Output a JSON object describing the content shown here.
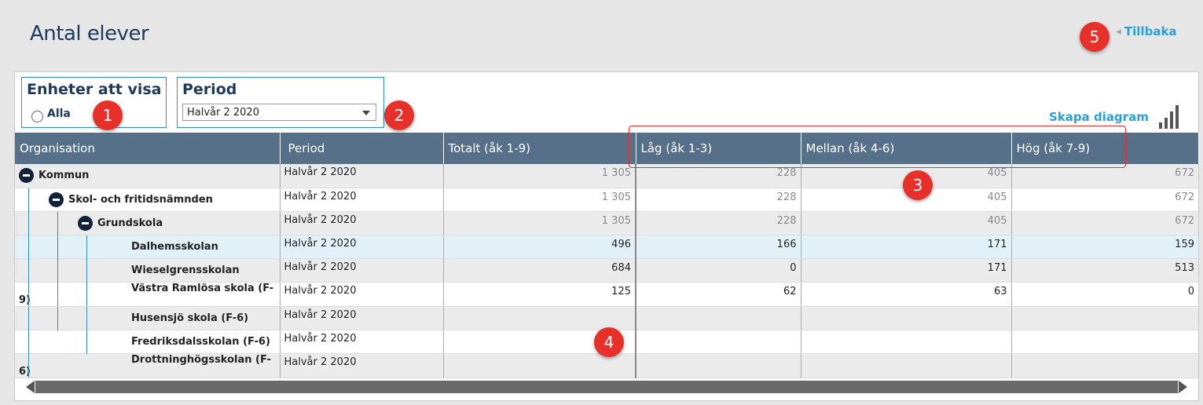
{
  "page": {
    "title": "Antal elever",
    "back_label": "Tillbaka"
  },
  "filters": {
    "units_title": "Enheter att visa",
    "units_option": "Alla",
    "period_title": "Period",
    "period_value": "Halvår 2 2020"
  },
  "chart_link": "Skapa diagram",
  "table": {
    "headers": [
      "Organisation",
      "Period",
      "Totalt (åk 1-9)",
      "Låg (åk 1-3)",
      "Mellan (åk 4-6)",
      "Hög (åk 7-9)"
    ],
    "rows": [
      {
        "org": "Kommun",
        "period": "Halvår 2 2020",
        "total": "1 305",
        "lag": "228",
        "mellan": "405",
        "hog": "672"
      },
      {
        "org": "Skol- och fritidsnämnden",
        "period": "Halvår 2 2020",
        "total": "1 305",
        "lag": "228",
        "mellan": "405",
        "hog": "672"
      },
      {
        "org": "Grundskola",
        "period": "Halvår 2 2020",
        "total": "1 305",
        "lag": "228",
        "mellan": "405",
        "hog": "672"
      },
      {
        "org": "Dalhemsskolan",
        "period": "Halvår 2 2020",
        "total": "496",
        "lag": "166",
        "mellan": "171",
        "hog": "159"
      },
      {
        "org": "Wieselgrensskolan",
        "period": "Halvår 2 2020",
        "total": "684",
        "lag": "0",
        "mellan": "171",
        "hog": "513"
      },
      {
        "org": "Västra Ramlösa skola (F-9)",
        "period": "Halvår 2 2020",
        "total": "125",
        "lag": "62",
        "mellan": "63",
        "hog": "0"
      },
      {
        "org": "Husensjö skola (F-6)",
        "period": "Halvår 2 2020",
        "total": "",
        "lag": "",
        "mellan": "",
        "hog": ""
      },
      {
        "org": "Fredriksdalsskolan (F-6)",
        "period": "Halvår 2 2020",
        "total": "",
        "lag": "",
        "mellan": "",
        "hog": ""
      },
      {
        "org": "Drottninghögsskolan (F-6)",
        "period": "Halvår 2 2020",
        "total": "",
        "lag": "",
        "mellan": "",
        "hog": ""
      }
    ]
  },
  "callouts": [
    "1",
    "2",
    "3",
    "4",
    "5"
  ],
  "colors": {
    "header_bg": "#557088",
    "accent": "#2aa0d8",
    "title": "#1d3a5c",
    "callout": "#e8302a"
  }
}
